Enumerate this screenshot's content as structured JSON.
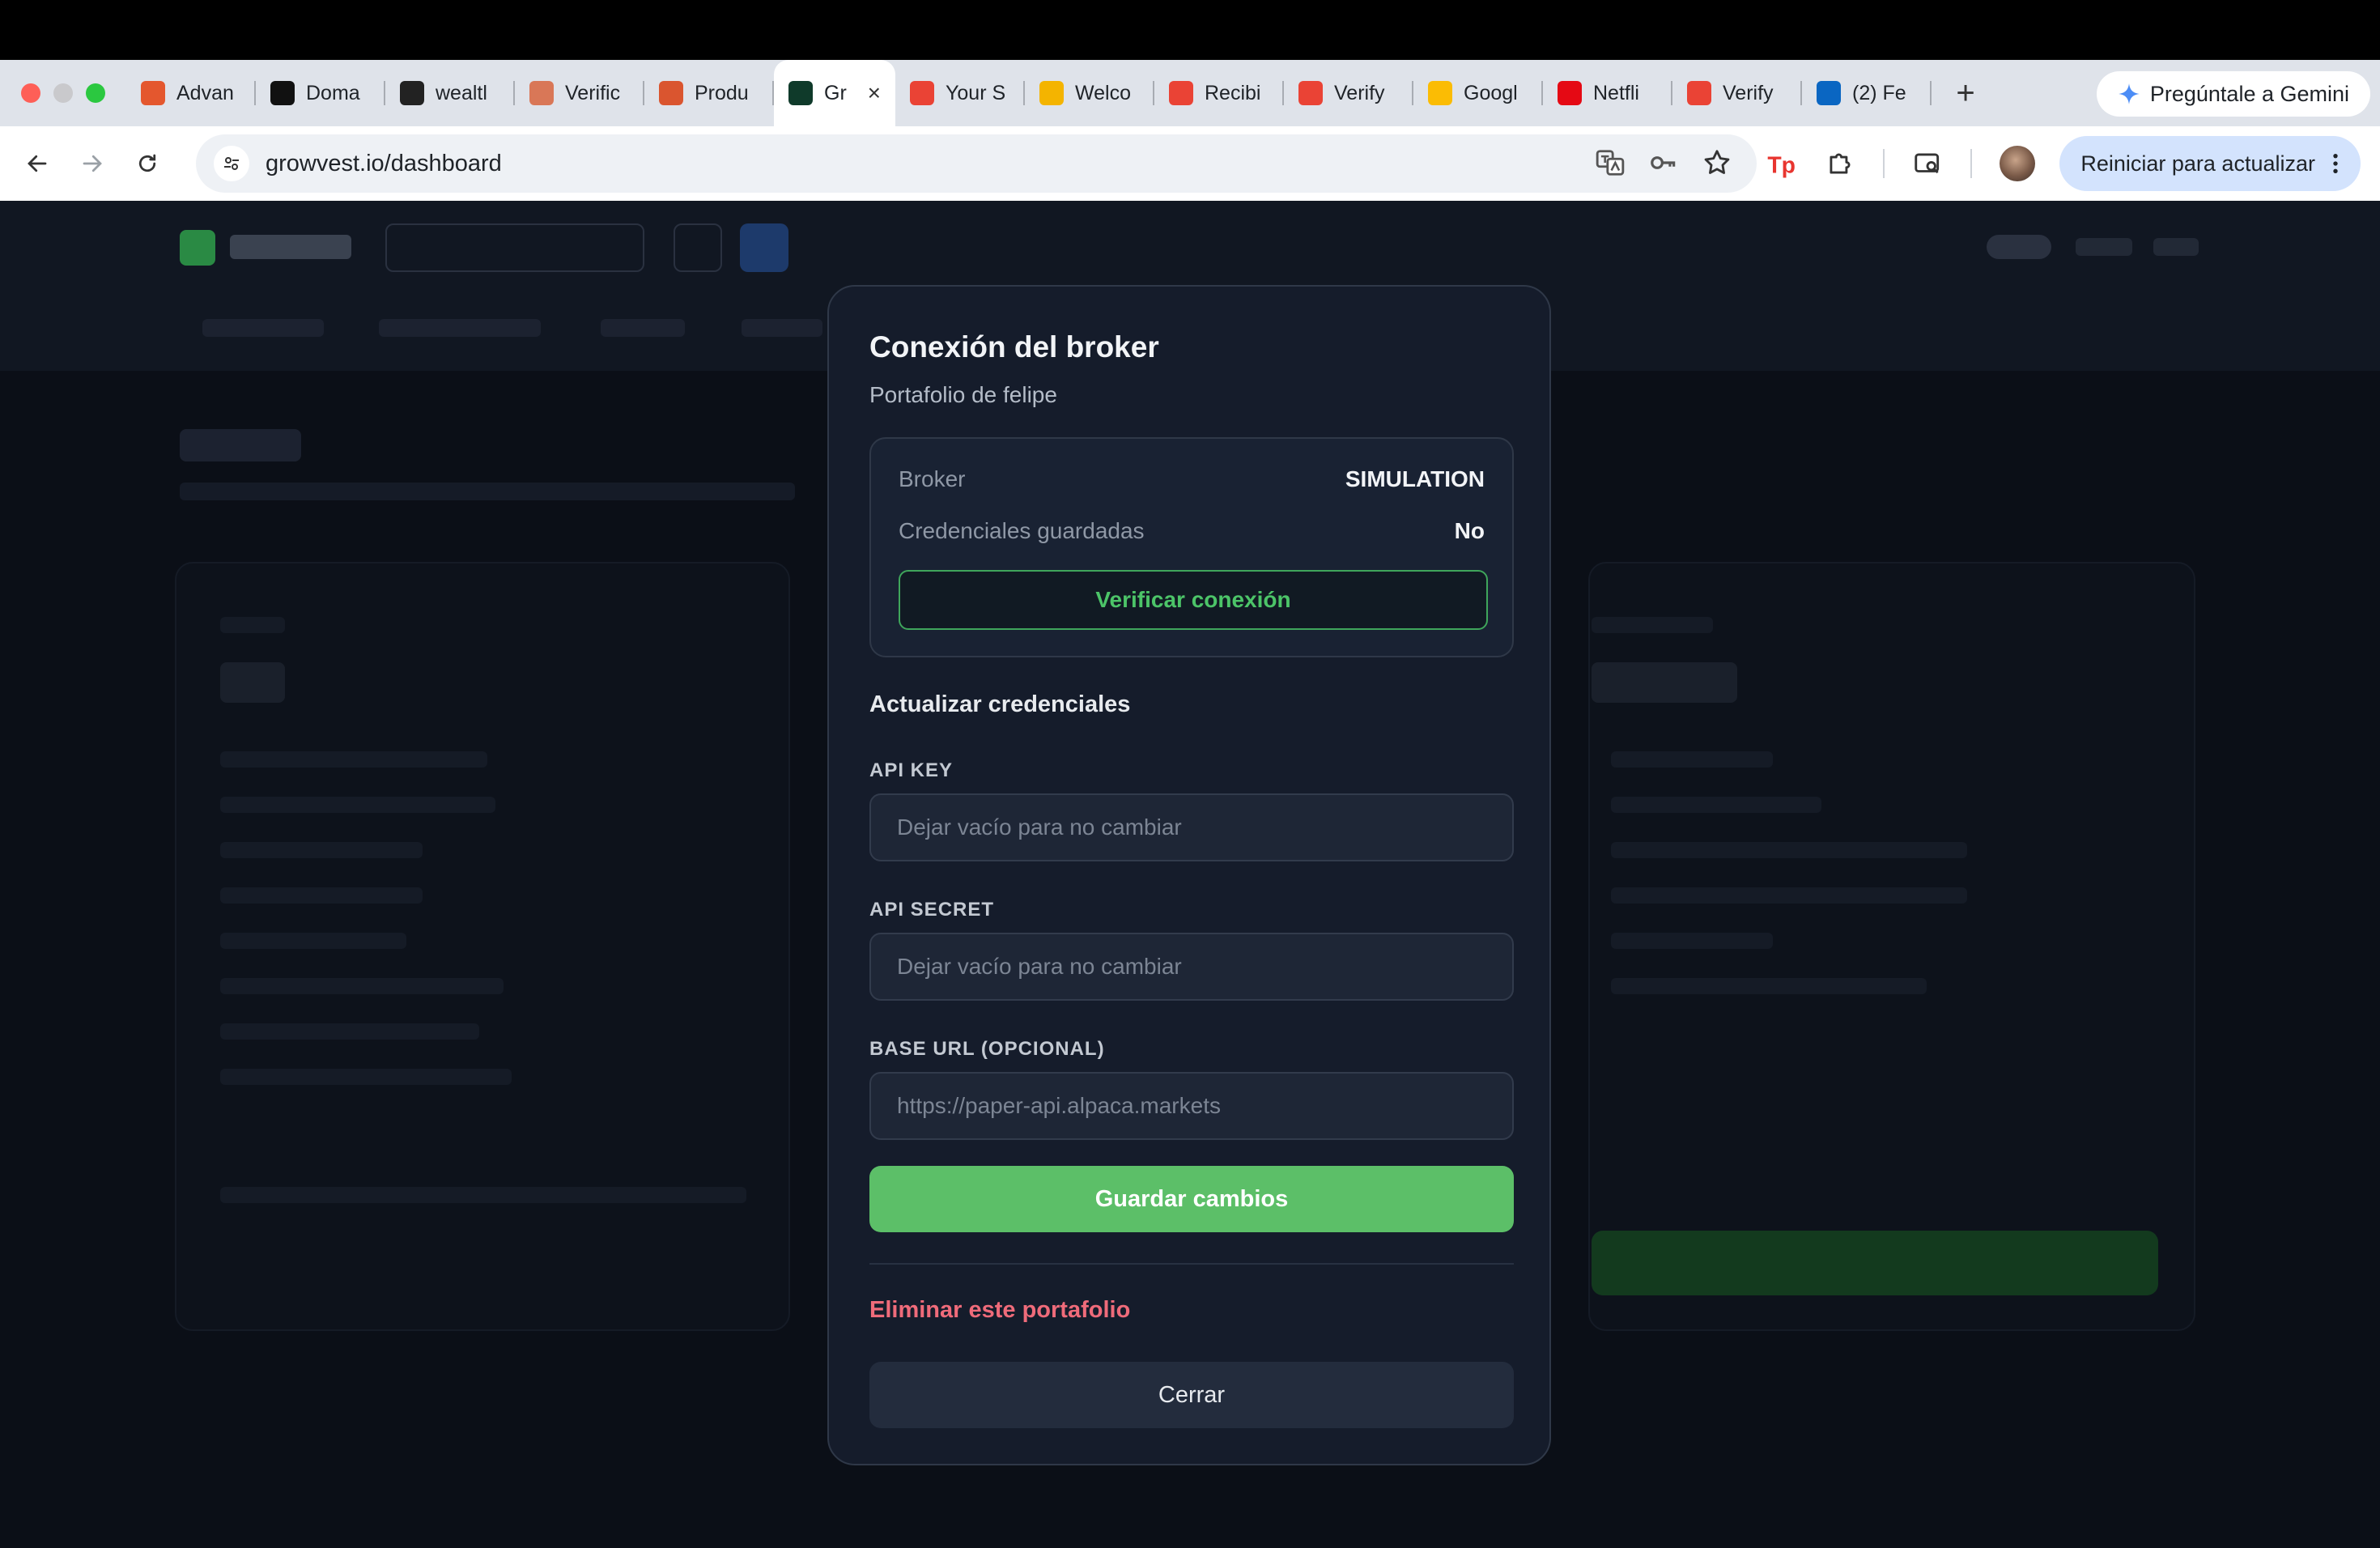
{
  "browser": {
    "tabs": [
      {
        "title": "Advan",
        "icon": "advan-favicon",
        "color": "#e4572e"
      },
      {
        "title": "Doma",
        "icon": "doma-favicon",
        "color": "#111111"
      },
      {
        "title": "wealtl",
        "icon": "wealth-favicon",
        "color": "#222222"
      },
      {
        "title": "Verific",
        "icon": "claude-favicon",
        "color": "#d97757"
      },
      {
        "title": "Produ",
        "icon": "producthunt-favicon",
        "color": "#da552f"
      },
      {
        "title": "Gr",
        "icon": "growvest-favicon",
        "color": "#0f3a2a"
      },
      {
        "title": "Your S",
        "icon": "gmail-favicon",
        "color": "#ea4335"
      },
      {
        "title": "Welco",
        "icon": "welcome-favicon",
        "color": "#f4b400"
      },
      {
        "title": "Recibi",
        "icon": "gmail-favicon",
        "color": "#ea4335"
      },
      {
        "title": "Verify",
        "icon": "gmail-favicon",
        "color": "#ea4335"
      },
      {
        "title": "Googl",
        "icon": "google-meet-favicon",
        "color": "#fbbc04"
      },
      {
        "title": "Netfli",
        "icon": "netflix-favicon",
        "color": "#e50914"
      },
      {
        "title": "Verify",
        "icon": "gmail-favicon",
        "color": "#ea4335"
      },
      {
        "title": "(2) Fe",
        "icon": "linkedin-favicon",
        "color": "#0a66c2"
      }
    ],
    "gemini_label": "Pregúntale a Gemini",
    "url": "growvest.io/dashboard",
    "update_label": "Reiniciar para actualizar"
  },
  "modal": {
    "title": "Conexión del broker",
    "subtitle": "Portafolio de felipe",
    "broker_label": "Broker",
    "broker_value": "SIMULATION",
    "creds_label": "Credenciales guardadas",
    "creds_value": "No",
    "verify_label": "Verificar conexión",
    "update_title": "Actualizar credenciales",
    "api_key_label": "API KEY",
    "api_key_placeholder": "Dejar vacío para no cambiar",
    "api_secret_label": "API SECRET",
    "api_secret_placeholder": "Dejar vacío para no cambiar",
    "base_url_label": "BASE URL (OPCIONAL)",
    "base_url_placeholder": "https://paper-api.alpaca.markets",
    "save_label": "Guardar cambios",
    "delete_label": "Eliminar este portafolio",
    "close_label": "Cerrar"
  },
  "colors": {
    "accent_green": "#5cbf68",
    "danger": "#ef6b7a",
    "modal_bg": "#151c2b"
  }
}
